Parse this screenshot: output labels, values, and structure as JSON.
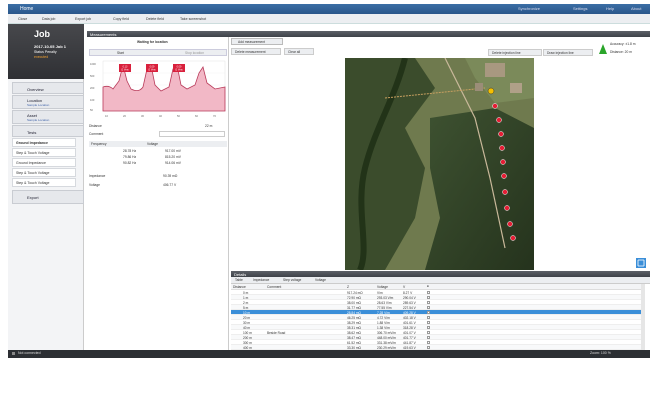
{
  "app": {
    "title": "Home",
    "status_right": [
      "Synchronize",
      "Settings",
      "Help",
      "About"
    ]
  },
  "toolbar": {
    "items": [
      "Close",
      "Data job",
      "Export job",
      "Copy field",
      "Delete field",
      "Take screenshot"
    ]
  },
  "job": {
    "title": "Job",
    "name": "2017-10-05 Job 1",
    "subtitle": "Status Penalty",
    "status": "executed"
  },
  "sidebar": {
    "items": [
      {
        "label": "Overview"
      },
      {
        "label": "Location",
        "sub": "Sample Location"
      },
      {
        "label": "Asset",
        "sub": "Sample Location"
      },
      {
        "label": "Tests"
      }
    ],
    "tests": [
      "Ground Impedance",
      "Step & Touch Voltage",
      "Ground Impedance",
      "Step & Touch Voltage",
      "Step & Touch Voltage"
    ],
    "export": "Export"
  },
  "measurements": {
    "header": "Measurements",
    "state": "Waiting for location",
    "tab_start": "Start",
    "tab_stop": "Stop location",
    "distance_label": "Distance",
    "distance_value": "22 m",
    "comment_label": "Comment",
    "freq_header": [
      "Frequency",
      "Voltage"
    ],
    "freq_rows": [
      [
        "28.78 Hz",
        "917.00 mV"
      ],
      [
        "79.86 Hz",
        "815.20 mV"
      ],
      [
        "90.82 Hz",
        "914.06 mV"
      ]
    ],
    "impedance_label": "Impedance",
    "impedance_value": "90.39 mΩ",
    "voltage_label": "Voltage",
    "voltage_value": "406.77 V",
    "peak_labels": [
      "0.13\nΩ Vms",
      "0.09\nΩ Vms",
      "0.09\nΩ Vms"
    ]
  },
  "map_toolbar": {
    "add": "Add measurement",
    "delete": "Delete measurement",
    "clear": "Clear all",
    "delete_line": "Delete injection line",
    "draw_line": "Draw injection line",
    "accuracy": "Accuracy: ±1.8 m",
    "distance": "Distance: 20 m"
  },
  "details": {
    "header": "Details",
    "tabs": [
      "Table",
      "Impedance",
      "Step voltage",
      "Voltage"
    ],
    "columns": [
      "Distance",
      "Comment",
      "Z",
      "Voltage",
      "V",
      ""
    ],
    "rows": [
      [
        "0 m",
        "",
        "917.24 mΩ",
        "V/m",
        "8.27 V"
      ],
      [
        "1 m",
        "",
        "72.90 mΩ",
        "293.03 V/m",
        "290.04 V"
      ],
      [
        "2 m",
        "",
        "38.00 mΩ",
        "28.63 V/m",
        "289.63 V"
      ],
      [
        "5 m",
        "",
        "31.77 mΩ",
        "77.55 V/m",
        "227.54 V"
      ],
      [
        "10 m",
        "",
        "28.84 mΩ",
        "7.28 V/m",
        "409.28 V"
      ],
      [
        "20 m",
        "",
        "46.25 mΩ",
        "4.72 V/m",
        "402.18 V"
      ],
      [
        "30 m",
        "",
        "38.29 mΩ",
        "1.88 V/m",
        "401.61 V"
      ],
      [
        "40 m",
        "",
        "35.31 mΩ",
        "1.38 V/m",
        "318.28 V"
      ],
      [
        "100 m",
        "Beside Road",
        "38.62 mΩ",
        "306.70 mV/m",
        "401.07 V"
      ],
      [
        "200 m",
        "",
        "38.47 mΩ",
        "448.00 mV/m",
        "401.77 V"
      ],
      [
        "300 m",
        "",
        "61.52 mΩ",
        "331.38 mV/m",
        "441.87 V"
      ],
      [
        "400 m",
        "",
        "33.30 mΩ",
        "230.29 mV/m",
        "419.63 V"
      ]
    ],
    "selected_row": 4
  },
  "statusbar": {
    "left": "Not connected",
    "zoom": "Zoom: 100 %"
  }
}
